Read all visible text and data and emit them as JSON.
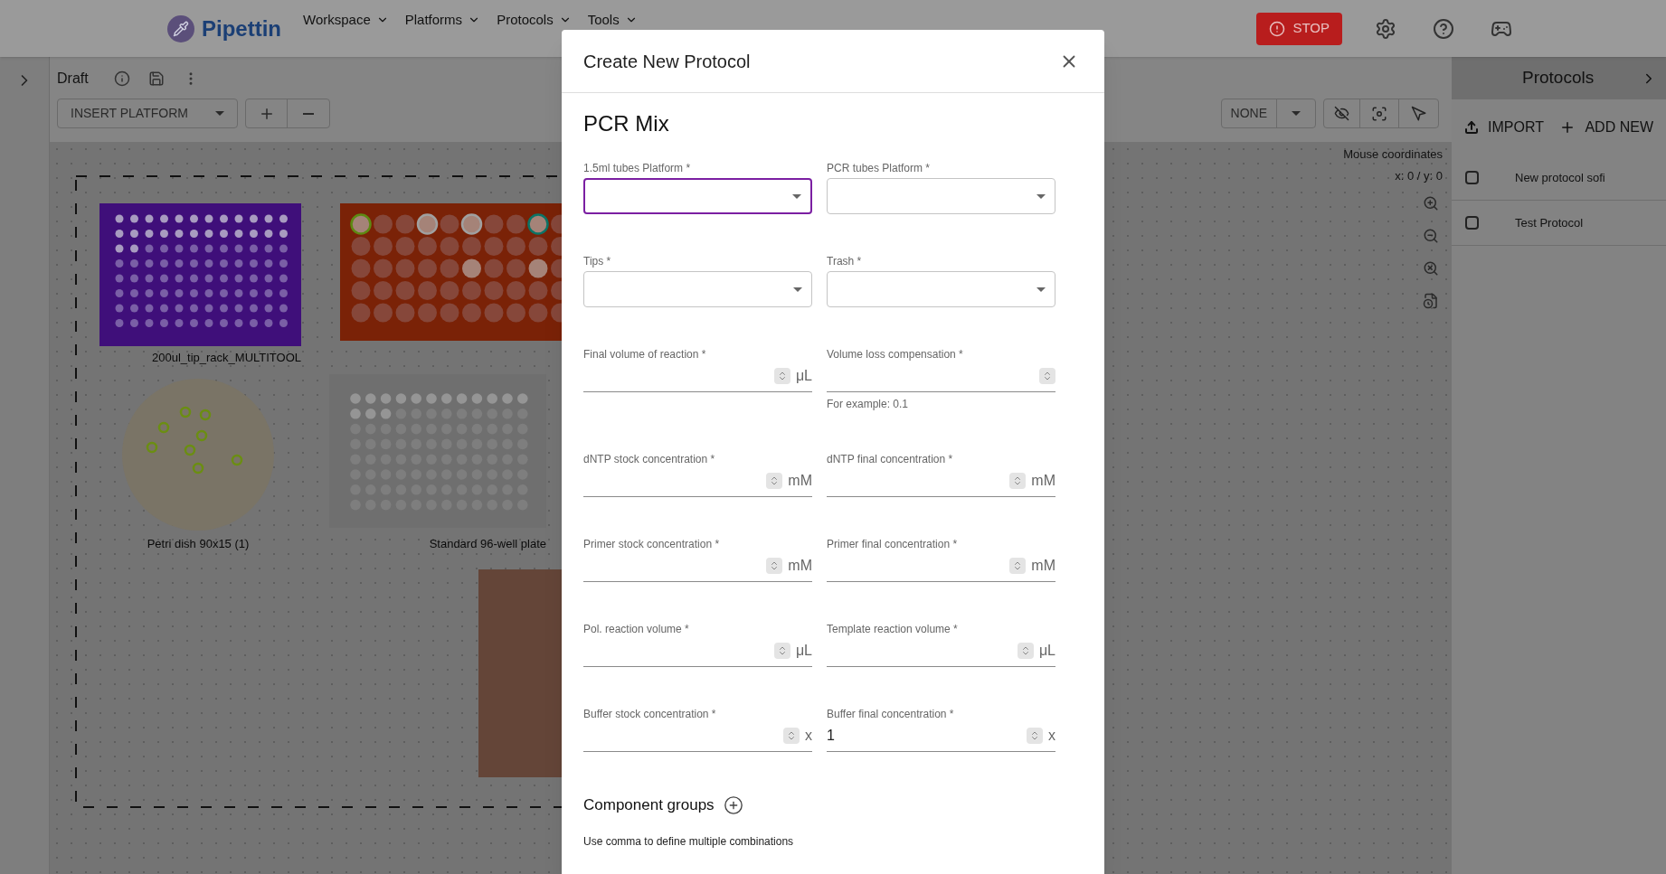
{
  "top_bar": {
    "logo_text": "Pipettin",
    "nav": [
      {
        "label": "Workspace"
      },
      {
        "label": "Platforms"
      },
      {
        "label": "Protocols"
      },
      {
        "label": "Tools"
      }
    ],
    "stop_button": "STOP"
  },
  "workspace": {
    "title": "Draft",
    "insert_platform": "INSERT PLATFORM",
    "view_mode": "NONE",
    "mouse_coordinates": {
      "label": "Mouse coordinates",
      "value": "x: 0 / y: 0"
    }
  },
  "canvas_items": [
    {
      "kind": "tip_rack",
      "label": "200ul_tip_rack_MULTITOOL",
      "color": "#3f0f7a"
    },
    {
      "kind": "tube_rack",
      "color": "#7a2207"
    },
    {
      "kind": "petri_dish",
      "label": "Petri dish 90x15 (1)",
      "color": "#7a7466"
    },
    {
      "kind": "well_plate",
      "label": "Standard 96-well plate",
      "color": "#6f6f6f"
    },
    {
      "kind": "block",
      "color": "#644538"
    }
  ],
  "protocols_panel": {
    "title": "Protocols",
    "actions": [
      {
        "kind": "import",
        "label": "IMPORT"
      },
      {
        "kind": "add",
        "label": "ADD NEW"
      }
    ],
    "items": [
      {
        "name": "New protocol sofi",
        "checked": false
      },
      {
        "name": "Test Protocol",
        "checked": false
      }
    ]
  },
  "dialog": {
    "title": "Create New Protocol",
    "section": "PCR Mix",
    "fields": [
      {
        "kind": "select",
        "label": "1.5ml tubes Platform *",
        "focused": true
      },
      {
        "kind": "select",
        "label": "PCR tubes Platform *",
        "focused": false
      },
      {
        "kind": "select",
        "label": "Tips *",
        "focused": false
      },
      {
        "kind": "select",
        "label": "Trash *",
        "focused": false
      },
      {
        "kind": "number",
        "label": "Final volume of reaction *",
        "unit": "μL"
      },
      {
        "kind": "number",
        "label": "Volume loss compensation *",
        "helper": "For example: 0.1"
      },
      {
        "kind": "number",
        "label": "dNTP stock concentration *",
        "unit": "mM"
      },
      {
        "kind": "number",
        "label": "dNTP final concentration *",
        "unit": "mM"
      },
      {
        "kind": "number",
        "label": "Primer stock concentration *",
        "unit": "mM"
      },
      {
        "kind": "number",
        "label": "Primer final concentration *",
        "unit": "mM"
      },
      {
        "kind": "number",
        "label": "Pol. reaction volume *",
        "unit": "μL"
      },
      {
        "kind": "number",
        "label": "Template reaction volume *",
        "unit": "μL"
      },
      {
        "kind": "number",
        "label": "Buffer stock concentration *",
        "unit": "x"
      },
      {
        "kind": "number",
        "label": "Buffer final concentration *",
        "unit": "x",
        "value": "1"
      }
    ],
    "groups_heading": "Component groups",
    "groups_hint": "Use comma to define multiple combinations"
  }
}
